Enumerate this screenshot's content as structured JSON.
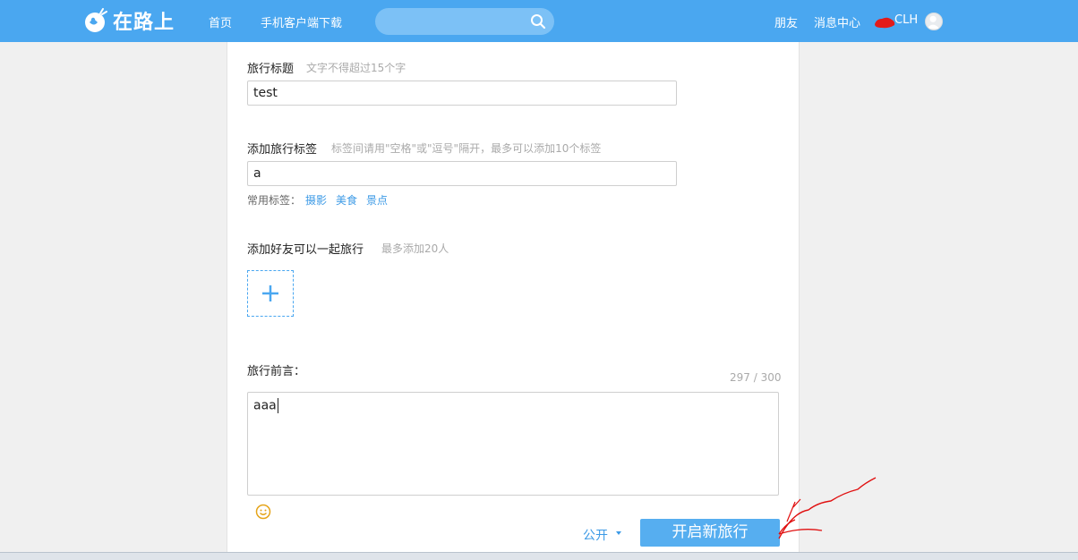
{
  "header": {
    "logo_text": "在路上",
    "nav": [
      "首页",
      "手机客户端下载"
    ],
    "search_placeholder": "",
    "friends_link": "朋友",
    "messages_link": "消息中心",
    "user_name": "CLH",
    "bar_color": "#4aa7f0"
  },
  "form": {
    "title_label": "旅行标题",
    "title_hint": "文字不得超过15个字",
    "title_value": "test",
    "tags_label": "添加旅行标签",
    "tags_hint": "标签间请用\"空格\"或\"逗号\"隔开，最多可以添加10个标签",
    "tags_value": "a",
    "common_tags_label": "常用标签：",
    "common_tags": [
      "摄影",
      "美食",
      "景点"
    ],
    "friends_label": "添加好友可以一起旅行",
    "friends_hint": "最多添加20人",
    "preface_label": "旅行前言：",
    "preface_counter": "297 / 300",
    "preface_value": "aaa",
    "privacy_value": "公开",
    "submit_label": "开启新旅行"
  },
  "icons": [
    "logo-mark-icon",
    "search-icon",
    "plus-icon",
    "emoji-icon",
    "chevron-down-icon",
    "avatar-icon"
  ],
  "colors": {
    "accent": "#4aa7f0",
    "link": "#3c9ae6",
    "button": "#56aef0",
    "annotation": "#e01010"
  }
}
